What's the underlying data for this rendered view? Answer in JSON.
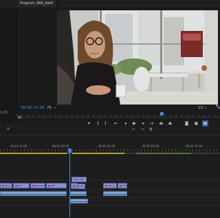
{
  "program_monitor": {
    "tab_title": "Program: 890_dsk0",
    "timecode": "00:00:33:08",
    "zoom": "Fit",
    "resolution": "1/2",
    "left_timecode": "1:23"
  },
  "icons": {
    "zoom_arrow": "▾",
    "resolution_arrow": "▾",
    "wrench": "wrench-icon",
    "plus": "+"
  },
  "transport": {
    "row1": [
      {
        "name": "add-marker-button",
        "glyph": "▾"
      },
      {
        "name": "mark-in-button",
        "glyph": "{"
      },
      {
        "name": "mark-out-button",
        "glyph": "}"
      },
      {
        "name": "go-to-in-button",
        "glyph": "⇤"
      },
      {
        "name": "step-back-button",
        "glyph": "◂"
      },
      {
        "name": "play-button",
        "glyph": "▶"
      },
      {
        "name": "step-forward-button",
        "glyph": "▸"
      },
      {
        "name": "go-to-out-button",
        "glyph": "⇥"
      },
      {
        "name": "lift-button",
        "glyph": "⏏"
      },
      {
        "name": "extract-button",
        "glyph": "⏏"
      },
      {
        "name": "export-frame-button",
        "glyph": "◙"
      },
      {
        "name": "comparison-view-button",
        "glyph": "▣"
      },
      {
        "name": "toggle-proxies-button",
        "glyph": "▤"
      }
    ],
    "row2": [
      {
        "name": "trim-in-button",
        "glyph": "⌐"
      },
      {
        "name": "trim-out-button",
        "glyph": "¬"
      },
      {
        "name": "insert-button",
        "glyph": "⇅"
      }
    ]
  },
  "timeline": {
    "ruler_labels": [
      "00:01:15:00",
      "00:01:30:00",
      "00:01:45:00",
      "00:02:00:00",
      "00:02:15:00"
    ],
    "clips_v1": [
      {
        "label": "890_dsk0"
      },
      {
        "label": "890"
      },
      {
        "label": "890_dsk0"
      },
      {
        "label": "890"
      },
      {
        "label": "890"
      },
      {
        "label": "890_d"
      },
      {
        "label": "890"
      }
    ],
    "clips_v2": [
      {
        "label": "890_dsk0"
      },
      {
        "label": "890_dsk0"
      }
    ],
    "clips_a1": [
      {
        "label": ""
      },
      {
        "label": ""
      },
      {
        "label": ""
      },
      {
        "label": ""
      }
    ]
  }
}
